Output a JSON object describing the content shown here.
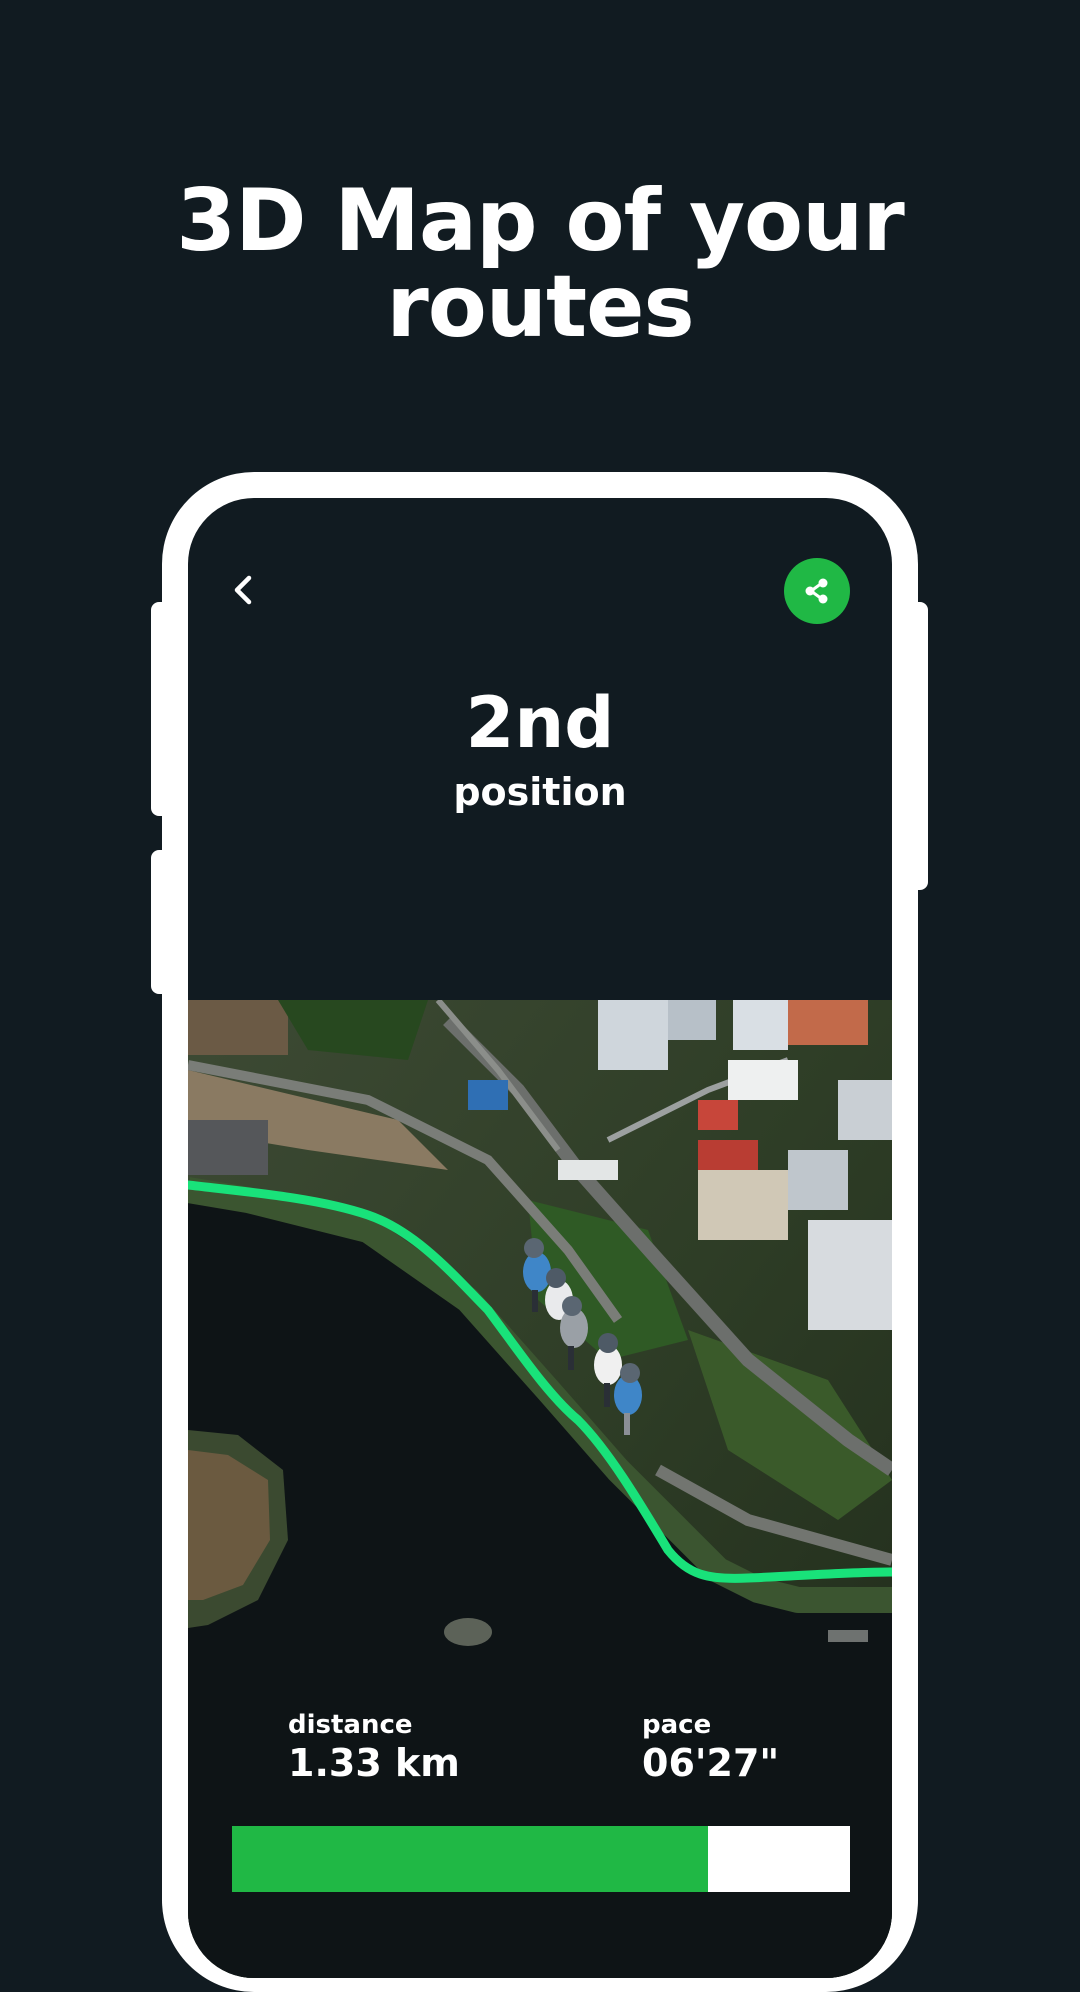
{
  "headline": {
    "line1": "3D Map of your",
    "line2": "routes"
  },
  "header": {
    "back_icon": "chevron-left-icon",
    "share_icon": "share-icon",
    "accent_color": "#20b845"
  },
  "result": {
    "rank": "2nd",
    "rank_label": "position"
  },
  "stats": {
    "distance_label": "distance",
    "distance_value": "1.33 km",
    "pace_label": "pace",
    "pace_value": "06'27\""
  },
  "progress": {
    "fraction": 0.77
  },
  "map": {
    "route_color": "#19e27a"
  }
}
